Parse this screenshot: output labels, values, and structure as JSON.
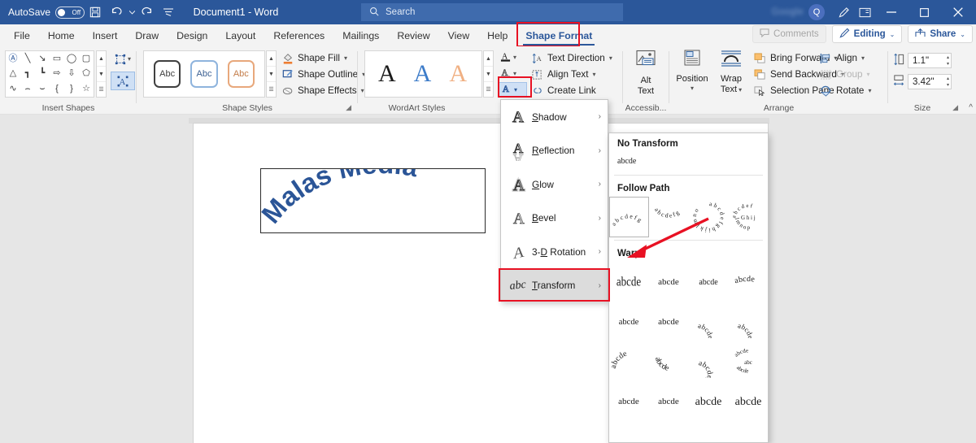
{
  "titlebar": {
    "autosave_label": "AutoSave",
    "autosave_state": "Off",
    "save_icon": "save-icon",
    "undo_icon": "undo-icon",
    "redo_icon": "redo-icon",
    "customize_icon": "customize-quick-access-icon",
    "document_title": "Document1  -  Word",
    "search_placeholder": "Search",
    "search_icon": "search-icon",
    "account_name": "Google",
    "avatar_initial": "Q",
    "pen_icon": "pen-feedback-icon",
    "ribbon_display_icon": "ribbon-display-options-icon",
    "minimize": "–",
    "maximize": "☐",
    "close": "✕",
    "accent_color": "#2b579a"
  },
  "tabs": [
    {
      "label": "File",
      "active": false
    },
    {
      "label": "Home",
      "active": false
    },
    {
      "label": "Insert",
      "active": false
    },
    {
      "label": "Draw",
      "active": false
    },
    {
      "label": "Design",
      "active": false
    },
    {
      "label": "Layout",
      "active": false
    },
    {
      "label": "References",
      "active": false
    },
    {
      "label": "Mailings",
      "active": false
    },
    {
      "label": "Review",
      "active": false
    },
    {
      "label": "View",
      "active": false
    },
    {
      "label": "Help",
      "active": false
    },
    {
      "label": "Shape Format",
      "active": true
    }
  ],
  "tab_right": {
    "comments": "Comments",
    "editing": "Editing",
    "share": "Share",
    "comment_icon": "comment-icon",
    "pencil_icon": "pencil-icon",
    "share_icon": "share-icon",
    "chevron": "⌄"
  },
  "ribbon": {
    "groups": [
      {
        "name": "Insert Shapes",
        "label": "Insert Shapes"
      },
      {
        "name": "Shape Styles",
        "label": "Shape Styles"
      },
      {
        "name": "WordArt Styles",
        "label": "WordArt Styles"
      },
      {
        "name": "Accessibility",
        "label": "Accessib..."
      },
      {
        "name": "Arrange",
        "label": "Arrange"
      },
      {
        "name": "Size",
        "label": "Size"
      }
    ],
    "insert_shapes": {
      "shapes": [
        "textbox",
        "line",
        "arrow",
        "rectangle",
        "oval",
        "rounded-rectangle",
        "triangle",
        "elbow-connector",
        "elbow-arrow",
        "block-arrow",
        "down-arrow",
        "pentagon",
        "scribble",
        "curve",
        "arc",
        "left-brace",
        "right-brace",
        "star"
      ],
      "glyphs": [
        "Ⓐ",
        "╲",
        "↘",
        "▭",
        "◯",
        "▢",
        "△",
        "┓",
        "┗",
        "⇨",
        "⇩",
        "⬠",
        "∿",
        "⌢",
        "⌣",
        "{",
        "}",
        "☆"
      ],
      "edit_shape_label": "Edit Shape",
      "draw_textbox_label": "Draw Text Box"
    },
    "shape_styles": {
      "samples": [
        "Abc",
        "Abc",
        "Abc"
      ],
      "commands": [
        {
          "label": "Shape Fill",
          "icon": "shape-fill-icon",
          "has_chevron": true
        },
        {
          "label": "Shape Outline",
          "icon": "shape-outline-icon",
          "has_chevron": true
        },
        {
          "label": "Shape Effects",
          "icon": "shape-effects-icon",
          "has_chevron": true
        }
      ]
    },
    "wordart_styles": {
      "samples": [
        "A",
        "A",
        "A"
      ],
      "buttons": [
        {
          "name": "text-fill",
          "glyph": "A",
          "selected": false
        },
        {
          "name": "text-outline",
          "glyph": "A",
          "selected": false
        },
        {
          "name": "text-effects",
          "glyph": "A",
          "selected": true
        }
      ],
      "text_commands": [
        {
          "label": "Text Direction",
          "icon": "text-direction-icon",
          "has_chevron": true
        },
        {
          "label": "Align Text",
          "icon": "align-text-icon",
          "has_chevron": true
        },
        {
          "label": "Create Link",
          "icon": "create-link-icon",
          "has_chevron": false
        }
      ]
    },
    "accessibility": {
      "alt_text_label": "Alt\nText",
      "alt_text_line1": "Alt",
      "alt_text_line2": "Text",
      "icon": "alt-text-picture-icon"
    },
    "arrange": {
      "position_label": "Position",
      "position_icon": "position-icon",
      "wrap_line1": "Wrap",
      "wrap_line2": "Text",
      "wrap_icon": "wrap-text-icon",
      "commands": [
        {
          "label": "Bring Forward",
          "icon": "bring-forward-icon",
          "has_chevron": true,
          "disabled": false
        },
        {
          "label": "Send Backward",
          "icon": "send-backward-icon",
          "has_chevron": true,
          "disabled": false
        },
        {
          "label": "Selection Pane",
          "icon": "selection-pane-icon",
          "has_chevron": false,
          "disabled": false
        }
      ],
      "commands2": [
        {
          "label": "Align",
          "icon": "align-icon",
          "has_chevron": true,
          "disabled": false
        },
        {
          "label": "Group",
          "icon": "group-icon",
          "has_chevron": true,
          "disabled": true
        },
        {
          "label": "Rotate",
          "icon": "rotate-icon",
          "has_chevron": true,
          "disabled": false
        }
      ]
    },
    "size": {
      "height_value": "1.1\"",
      "height_icon": "shape-height-icon",
      "width_value": "3.42\"",
      "width_icon": "shape-width-icon",
      "dialog_launcher": "size-dialog-launcher"
    },
    "collapse_ribbon": "collapse-ribbon-icon"
  },
  "document": {
    "wordart_text": "Malas Media",
    "wordart_color": "#2b5597",
    "wordart_transform": "follow-path-arch-up"
  },
  "effects_menu": {
    "items": [
      {
        "label": "Shadow",
        "underline": "S",
        "icon": "shadow-A-icon",
        "selected": false
      },
      {
        "label": "Reflection",
        "underline": "R",
        "icon": "reflection-A-icon",
        "selected": false
      },
      {
        "label": "Glow",
        "underline": "G",
        "icon": "glow-A-icon",
        "selected": false
      },
      {
        "label": "Bevel",
        "underline": "B",
        "icon": "bevel-A-icon",
        "selected": false
      },
      {
        "label": "3-D Rotation",
        "underline": "D",
        "icon": "rotation-A-icon",
        "selected": false
      },
      {
        "label": "Transform",
        "underline": "T",
        "icon": "transform-abc-icon",
        "selected": true
      }
    ],
    "submenu_arrow": "›"
  },
  "transform_menu": {
    "sections": [
      {
        "heading": "No Transform",
        "type": "single",
        "sample": "abcde"
      },
      {
        "heading": "Follow Path",
        "type": "grid",
        "items": [
          {
            "name": "arch-up",
            "selected": true
          },
          {
            "name": "arch-down",
            "selected": false
          },
          {
            "name": "circle",
            "selected": false
          },
          {
            "name": "button",
            "selected": false
          }
        ]
      },
      {
        "heading": "Warp",
        "type": "grid",
        "items": [
          {
            "name": "inflate",
            "selected": false
          },
          {
            "name": "deflate",
            "selected": false
          },
          {
            "name": "inflate-bottom",
            "selected": false
          },
          {
            "name": "deflate-bottom",
            "selected": false
          },
          {
            "name": "inflate-top",
            "selected": false
          },
          {
            "name": "deflate-top",
            "selected": false
          },
          {
            "name": "deflate-inflate",
            "selected": false
          },
          {
            "name": "deflate-inflate-deflate",
            "selected": false
          },
          {
            "name": "fade-right",
            "selected": false
          },
          {
            "name": "fade-left",
            "selected": false
          },
          {
            "name": "fade-up",
            "selected": false
          },
          {
            "name": "fade-down",
            "selected": false
          },
          {
            "name": "slant-up",
            "selected": false
          },
          {
            "name": "slant-down",
            "selected": false
          },
          {
            "name": "can-up",
            "selected": false
          },
          {
            "name": "can-down",
            "selected": false
          }
        ]
      }
    ],
    "sample_text": "abcde",
    "path_letters": "abcdefg",
    "circle_letters": "abcdefghijklmno",
    "button_letters_outer": "abcdef",
    "button_letters_mid": "Ghij",
    "button_letters_inner": "lmnop"
  },
  "annotations": {
    "arrow_color": "#e81123",
    "highlight_color": "#e81123",
    "highlights": [
      "shape-format-tab",
      "text-effects-button",
      "transform-menu-item"
    ],
    "arrow_target": "follow-path-arch-up"
  }
}
